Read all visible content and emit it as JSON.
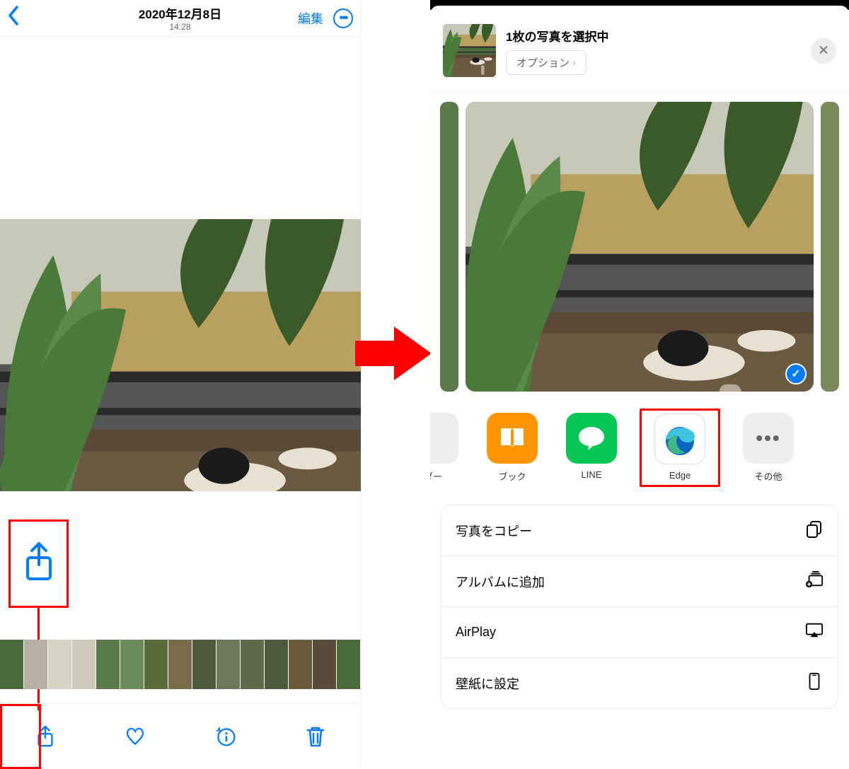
{
  "left": {
    "date": "2020年12月8日",
    "time": "14:28",
    "edit_label": "編集"
  },
  "right": {
    "selection_title": "1枚の写真を選択中",
    "option_label": "オプション",
    "apps": {
      "peek": "ダー",
      "books": "ブック",
      "line": "LINE",
      "edge": "Edge",
      "more": "その他"
    },
    "actions": {
      "copy": "写真をコピー",
      "album": "アルバムに追加",
      "airplay": "AirPlay",
      "wallpaper": "壁紙に設定"
    }
  }
}
